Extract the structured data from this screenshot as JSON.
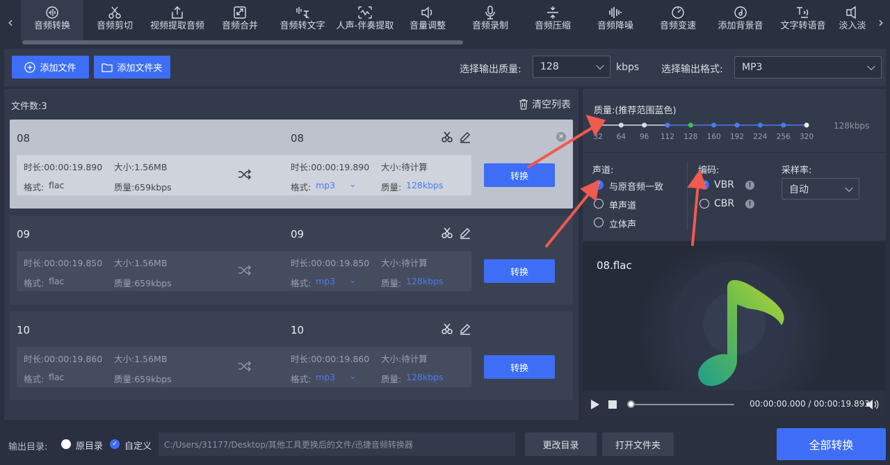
{
  "nav": {
    "tabs": [
      {
        "label": "音频转换",
        "icon": "audio-convert-icon"
      },
      {
        "label": "音频剪切",
        "icon": "scissors-icon"
      },
      {
        "label": "视频提取音频",
        "icon": "export-icon"
      },
      {
        "label": "音频合并",
        "icon": "merge-icon"
      },
      {
        "label": "音频转文字",
        "icon": "audio-to-text-icon"
      },
      {
        "label": "人声-伴奏提取",
        "icon": "vocal-extract-icon"
      },
      {
        "label": "音量调整",
        "icon": "volume-icon"
      },
      {
        "label": "音频录制",
        "icon": "microphone-icon"
      },
      {
        "label": "音频压缩",
        "icon": "compress-icon"
      },
      {
        "label": "音频降噪",
        "icon": "denoise-icon"
      },
      {
        "label": "音频变速",
        "icon": "speed-icon"
      },
      {
        "label": "添加背景音",
        "icon": "music-disc-icon"
      },
      {
        "label": "文字转语音",
        "icon": "text-to-speech-icon"
      },
      {
        "label": "淡入淡",
        "icon": "fade-icon"
      }
    ]
  },
  "toolbar": {
    "add_file": "添加文件",
    "add_folder": "添加文件夹",
    "quality_label": "选择输出质量:",
    "quality_value": "128",
    "quality_unit": "kbps",
    "format_label": "选择输出格式:",
    "format_value": "MP3"
  },
  "list": {
    "file_count": "文件数:3",
    "clear_label": "清空列表",
    "files": [
      {
        "name": "08",
        "src_duration": "时长:00:00:19.890",
        "src_size": "大小:1.56MB",
        "src_format_label": "格式:",
        "src_format": "flac",
        "src_quality": "质量:659kbps",
        "dst_name": "08",
        "dst_duration": "时长:00:00:19.890",
        "dst_size": "大小:待计算",
        "dst_format_label": "格式:",
        "dst_format": "mp3",
        "dst_quality_label": "质量:",
        "dst_quality": "128kbps",
        "convert": "转换"
      },
      {
        "name": "09",
        "src_duration": "时长:00:00:19.850",
        "src_size": "大小:1.56MB",
        "src_format_label": "格式:",
        "src_format": "flac",
        "src_quality": "质量:659kbps",
        "dst_name": "09",
        "dst_duration": "时长:00:00:19.850",
        "dst_size": "大小:待计算",
        "dst_format_label": "格式:",
        "dst_format": "mp3",
        "dst_quality_label": "质量:",
        "dst_quality": "128kbps",
        "convert": "转换"
      },
      {
        "name": "10",
        "src_duration": "时长:00:00:19.860",
        "src_size": "大小:1.56MB",
        "src_format_label": "格式:",
        "src_format": "flac",
        "src_quality": "质量:659kbps",
        "dst_name": "10",
        "dst_duration": "时长:00:00:19.860",
        "dst_size": "大小:待计算",
        "dst_format_label": "格式:",
        "dst_format": "mp3",
        "dst_quality_label": "质量:",
        "dst_quality": "128kbps",
        "convert": "转换"
      }
    ]
  },
  "settings": {
    "quality_title": "质量:(推荐范围蓝色)",
    "quality_ticks": [
      "32",
      "64",
      "96",
      "112",
      "128",
      "160",
      "192",
      "224",
      "256",
      "320"
    ],
    "quality_selected": "128",
    "quality_readout": "128kbps",
    "channel_title": "声道:",
    "channel_options": [
      "与原音频一致",
      "单声道",
      "立体声"
    ],
    "channel_selected": 0,
    "encoding_title": "编码:",
    "encoding_options": [
      "VBR",
      "CBR"
    ],
    "encoding_selected": 0,
    "samplerate_title": "采样率:",
    "samplerate_value": "自动"
  },
  "preview": {
    "filename": "08.flac",
    "time": "00:00:00.000 / 00:00:19.893",
    "progress": 0
  },
  "bottom": {
    "output_label": "输出目录:",
    "opt_original": "原目录",
    "opt_custom": "自定义",
    "path": "C:/Users/31177/Desktop/其他工具更换后的文件/迅捷音频转换器",
    "change_dir": "更改目录",
    "open_folder": "打开文件夹",
    "convert_all": "全部转换"
  },
  "colors": {
    "accent": "#3d6ef5",
    "recommended": "#4a7cf2",
    "selected_tick": "#3fbf5a",
    "arrow": "#f05a4f"
  }
}
